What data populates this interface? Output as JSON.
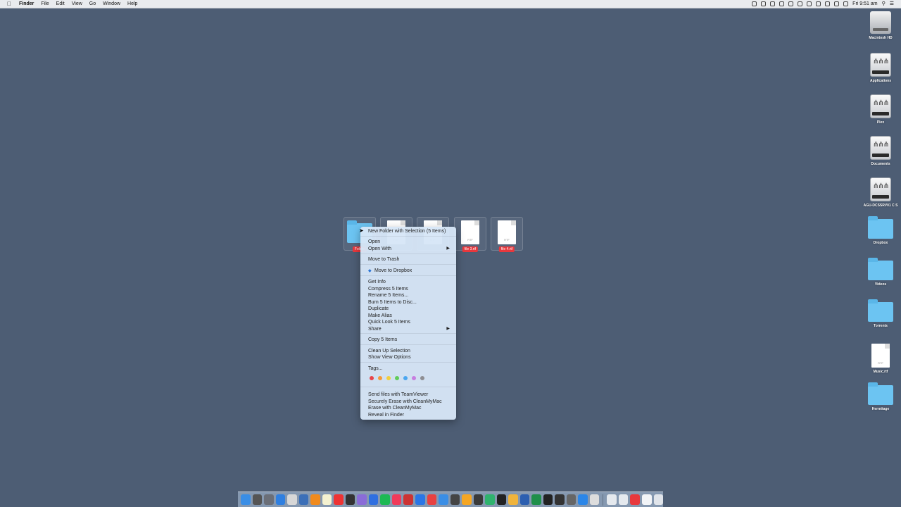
{
  "menubar": {
    "app_name": "Finder",
    "menus": [
      "Edit",
      "View",
      "Go",
      "Window",
      "Help"
    ],
    "clock": "Fri 9:51 am"
  },
  "desktop_icons": [
    {
      "label": "Macintosh HD",
      "kind": "hd"
    },
    {
      "label": "Applications",
      "kind": "net"
    },
    {
      "label": "Plex",
      "kind": "net"
    },
    {
      "label": "Documents",
      "kind": "net"
    },
    {
      "label": "AGU-DCSSRV01 C S",
      "kind": "net"
    },
    {
      "label": "Dropbox",
      "kind": "folder"
    },
    {
      "label": "Videos",
      "kind": "folder"
    },
    {
      "label": "Torrents",
      "kind": "folder"
    },
    {
      "label": "Music.rtf",
      "kind": "doc"
    },
    {
      "label": "Hermitage",
      "kind": "folder"
    }
  ],
  "selected_items": [
    {
      "label": "Folder",
      "kind": "folder"
    },
    {
      "label": "",
      "kind": "doc"
    },
    {
      "label": "",
      "kind": "doc"
    },
    {
      "label": "file 3.rtf",
      "kind": "doc"
    },
    {
      "label": "file 4.rtf",
      "kind": "doc"
    }
  ],
  "context_menu": {
    "items": [
      {
        "label": "New Folder with Selection (5 Items)",
        "submenu": false
      },
      {
        "label": "Open",
        "submenu": false
      },
      {
        "label": "Open With",
        "submenu": true
      },
      {
        "label": "Move to Trash",
        "submenu": false
      },
      {
        "label": "Move to Dropbox",
        "submenu": false,
        "icon": "dropbox-icon"
      },
      {
        "label": "Get Info",
        "submenu": false
      },
      {
        "label": "Compress 5 Items",
        "submenu": false
      },
      {
        "label": "Rename 5 Items...",
        "submenu": false
      },
      {
        "label": "Burn 5 Items to Disc...",
        "submenu": false
      },
      {
        "label": "Duplicate",
        "submenu": false
      },
      {
        "label": "Make Alias",
        "submenu": false
      },
      {
        "label": "Quick Look 5 Items",
        "submenu": false
      },
      {
        "label": "Share",
        "submenu": true
      },
      {
        "label": "Copy 5 Items",
        "submenu": false
      },
      {
        "label": "Clean Up Selection",
        "submenu": false
      },
      {
        "label": "Show View Options",
        "submenu": false
      },
      {
        "label": "Tags...",
        "submenu": false
      },
      {
        "label": "Send files with TeamViewer",
        "submenu": false
      },
      {
        "label": "Securely Erase with CleanMyMac",
        "submenu": false
      },
      {
        "label": "Erase with CleanMyMac",
        "submenu": false
      },
      {
        "label": "Reveal in Finder",
        "submenu": false
      }
    ],
    "tag_colors": [
      "#e8454b",
      "#f59a3b",
      "#f2cf3c",
      "#62cc5a",
      "#4aa6f0",
      "#c77ee0",
      "#8e8e93"
    ]
  },
  "dock": {
    "app_colors": [
      "#3a8ee6",
      "#555",
      "#6b6f78",
      "#2f7fe0",
      "#d7d7d7",
      "#3b6fb8",
      "#f08a1c",
      "#f4f1d0",
      "#e33",
      "#333",
      "#8a6cd8",
      "#2f6fe0",
      "#1db954",
      "#f03a5a",
      "#c33",
      "#2a76e6",
      "#e84141",
      "#3a8ee6",
      "#444",
      "#f5a623",
      "#3a3a3a",
      "#2fb36e",
      "#222",
      "#f0b43c",
      "#2c5fb0",
      "#1f8f4a",
      "#222",
      "#333",
      "#666",
      "#2b86e8",
      "#ddd"
    ],
    "right_colors": [
      "#e5e9ee",
      "#e5e9ee",
      "#e8383d",
      "#f2f4f7",
      "#e0e4ea"
    ]
  }
}
